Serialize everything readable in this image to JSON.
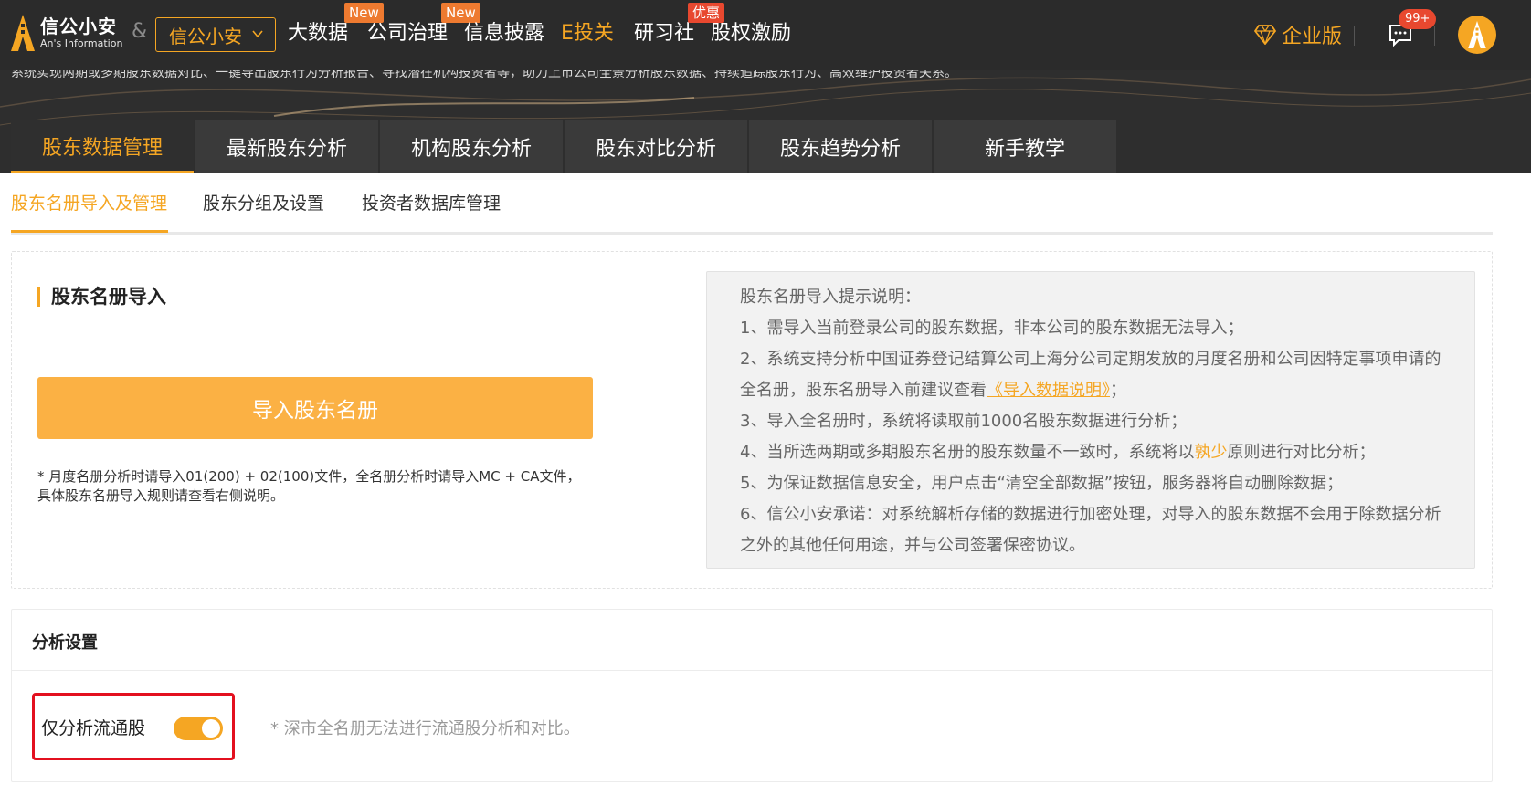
{
  "topbar": {
    "logo_cn": "信公小安",
    "logo_en": "An's Information",
    "amp": "&",
    "company_select": "信公小安",
    "nav": [
      {
        "label": "大数据",
        "badge": "New"
      },
      {
        "label": "公司治理",
        "badge": "New"
      },
      {
        "label": "信息披露",
        "badge": ""
      },
      {
        "label": "E投关",
        "badge": ""
      },
      {
        "label": "研习社",
        "badge": "优惠"
      },
      {
        "label": "股权激励",
        "badge": ""
      }
    ],
    "enterprise_label": "企业版",
    "message_count": "99+"
  },
  "hero": {
    "text": "系统实现两期或多期股东数据对比、一键导出股东行为分析报告、寻找潜在机构投资者等，助力上市公司全景分析股东数据、持续追踪股东行为、高效维护投资者关系。"
  },
  "main_tabs": [
    "股东数据管理",
    "最新股东分析",
    "机构股东分析",
    "股东对比分析",
    "股东趋势分析",
    "新手教学"
  ],
  "sub_tabs": [
    "股东名册导入及管理",
    "股东分组及设置",
    "投资者数据库管理"
  ],
  "import_panel": {
    "title": "股东名册导入",
    "button": "导入股东名册",
    "note": "* 月度名册分析时请导入01(200) + 02(100)文件，全名册分析时请导入MC + CA文件，具体股东名册导入规则请查看右侧说明。"
  },
  "tips": {
    "heading": "股东名册导入提示说明：",
    "t1": "1、需导入当前登录公司的股东数据，非本公司的股东数据无法导入；",
    "t2_a": "2、系统支持分析中国证券登记结算公司上海分公司定期发放的月度名册和公司因特定事项申请的全名册，股东名册导入前建议查看",
    "t2_link": "《导入数据说明》",
    "t2_b": "；",
    "t3": "3、导入全名册时，系统将读取前1000名股东数据进行分析；",
    "t4_a": "4、当所选两期或多期股东名册的股东数量不一致时，系统将以",
    "t4_hl": "孰少",
    "t4_b": "原则进行对比分析；",
    "t5": "5、为保证数据信息安全，用户点击“清空全部数据”按钮，服务器将自动删除数据；",
    "t6": "6、信公小安承诺：对系统解析存储的数据进行加密处理，对导入的股东数据不会用于除数据分析之外的其他任何用途，并与公司签署保密协议。"
  },
  "settings": {
    "title": "分析设置",
    "toggle_label": "仅分析流通股",
    "toggle_on": true,
    "note": "* 深市全名册无法进行流通股分析和对比。"
  },
  "colors": {
    "accent": "#f5a623",
    "nav_bg": "#2b2b2b",
    "badge_new": "#ee7a30",
    "badge_promo": "#e8482f",
    "highlight_border": "#e3101f"
  }
}
